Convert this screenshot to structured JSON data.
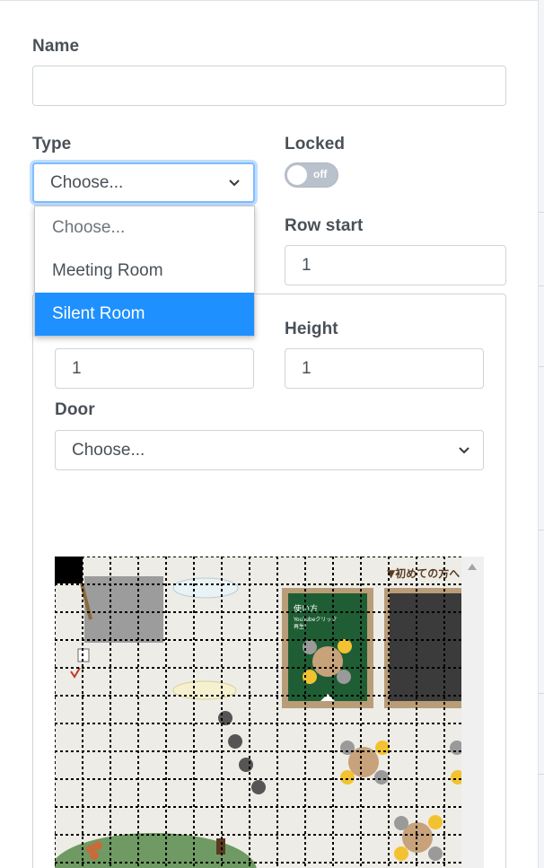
{
  "form": {
    "name": {
      "label": "Name",
      "value": "",
      "placeholder": ""
    },
    "type": {
      "label": "Type",
      "value": "Choose...",
      "options": [
        "Choose...",
        "Meeting Room",
        "Silent Room"
      ],
      "highlighted": "Silent Room"
    },
    "locked": {
      "label": "Locked",
      "state_text": "off"
    },
    "row_start": {
      "label": "Row start",
      "value": "1"
    },
    "width": {
      "value": "1"
    },
    "height": {
      "label": "Height",
      "value": "1"
    },
    "door": {
      "label": "Door",
      "value": "Choose..."
    }
  },
  "map": {
    "heading": "▼初めての方へ",
    "board_title": "使い方",
    "board_line1": "YouTubeクリック",
    "board_line2": "再生!",
    "bubble1": "",
    "bubble2": ""
  },
  "colors": {
    "accent": "#1e90ff",
    "focus_border": "#80bdff",
    "board_green": "#1f5e34",
    "table_wood": "#c7a27a",
    "chair_yellow": "#f2c230",
    "chair_gray": "#9a9a9a"
  }
}
